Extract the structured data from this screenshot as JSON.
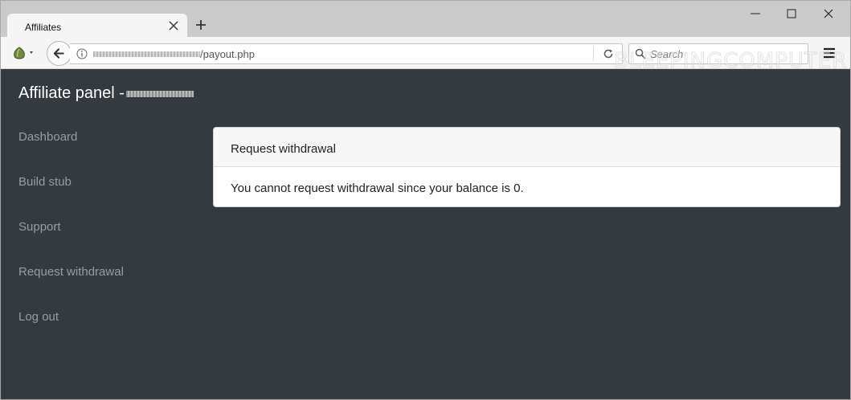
{
  "browser": {
    "tab_title": "Affiliates",
    "url_path": "/payout.php",
    "search_placeholder": "Search"
  },
  "watermark": "BLEEPINGCOMPUTER",
  "panel": {
    "brand": "Affiliate panel -",
    "nav": [
      {
        "label": "Dashboard"
      },
      {
        "label": "Build stub"
      },
      {
        "label": "Support"
      },
      {
        "label": "Request withdrawal"
      },
      {
        "label": "Log out"
      }
    ],
    "card": {
      "header": "Request withdrawal",
      "message": "You cannot request withdrawal since your balance is 0."
    }
  },
  "icons": {
    "tab_close": "close-icon",
    "new_tab": "plus-icon",
    "back": "back-arrow-icon",
    "info": "info-icon",
    "reload": "reload-icon",
    "search": "search-icon",
    "menu": "hamburger-menu-icon",
    "tor": "tor-onion-icon"
  },
  "colors": {
    "page_background": "#343a40",
    "nav_text": "#9a9da0",
    "card_header_bg": "#f7f7f7"
  }
}
